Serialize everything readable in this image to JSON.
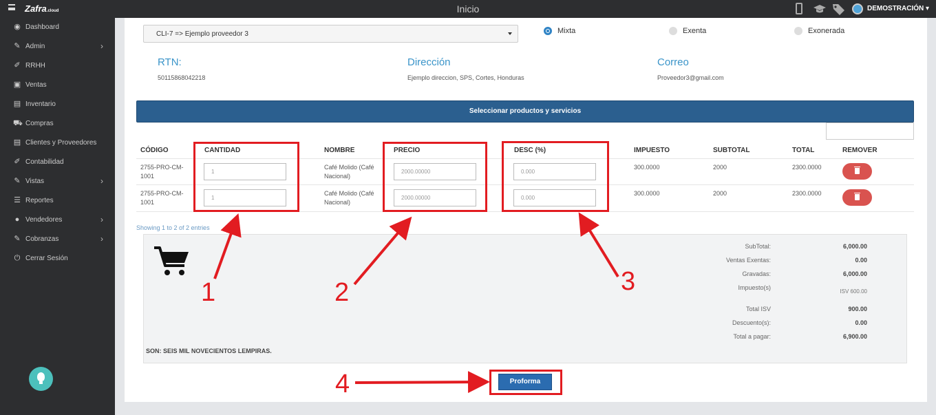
{
  "topbar": {
    "logo": "Zafra",
    "logo_suffix": ".cloud",
    "title": "Inicio",
    "user": "DEMOSTRACIÓN"
  },
  "sidebar": {
    "items": [
      {
        "label": "Dashboard",
        "icon": "dashboard-icon",
        "glyph": "◉",
        "has_submenu": false
      },
      {
        "label": "Admin",
        "icon": "wrench-icon",
        "glyph": "✎",
        "has_submenu": true
      },
      {
        "label": "RRHH",
        "icon": "paperclip-icon",
        "glyph": "✐",
        "has_submenu": false
      },
      {
        "label": "Ventas",
        "icon": "money-icon",
        "glyph": "▣",
        "has_submenu": false
      },
      {
        "label": "Inventario",
        "icon": "book-icon",
        "glyph": "▤",
        "has_submenu": false
      },
      {
        "label": "Compras",
        "icon": "cart-icon",
        "glyph": "⛟",
        "has_submenu": false
      },
      {
        "label": "Clientes y Proveedores",
        "icon": "book-icon",
        "glyph": "▤",
        "has_submenu": false
      },
      {
        "label": "Contabilidad",
        "icon": "paperclip-icon",
        "glyph": "✐",
        "has_submenu": false
      },
      {
        "label": "Vistas",
        "icon": "edit-icon",
        "glyph": "✎",
        "has_submenu": true
      },
      {
        "label": "Reportes",
        "icon": "list-icon",
        "glyph": "☰",
        "has_submenu": false
      },
      {
        "label": "Vendedores",
        "icon": "user-icon",
        "glyph": "●",
        "has_submenu": true
      },
      {
        "label": "Cobranzas",
        "icon": "edit-icon",
        "glyph": "✎",
        "has_submenu": true
      },
      {
        "label": "Cerrar Sesión",
        "icon": "power-icon",
        "glyph": "⏻",
        "has_submenu": false
      }
    ]
  },
  "form": {
    "supplier_select": "CLI-7 => Ejemplo proveedor 3",
    "radios": [
      {
        "label": "Mixta",
        "selected": true
      },
      {
        "label": "Exenta",
        "selected": false
      },
      {
        "label": "Exonerada",
        "selected": false
      }
    ],
    "rtn_label": "RTN:",
    "rtn_value": "50115868042218",
    "address_label": "Dirección",
    "address_value": "Ejemplo direccion, SPS, Cortes, Honduras",
    "email_label": "Correo",
    "email_value": "Proveedor3@gmail.com",
    "select_products_button": "Seleccionar productos y servicios",
    "search_value": ""
  },
  "table": {
    "headers": [
      "CÓDIGO",
      "CANTIDAD",
      "NOMBRE",
      "PRECIO",
      "DESC (%)",
      "IMPUESTO",
      "SUBTOTAL",
      "TOTAL",
      "REMOVER"
    ],
    "rows": [
      {
        "code_l1": "2755-PRO-CM-",
        "code_l2": "1001",
        "qty": "1",
        "name_l1": "Café Molido (Café",
        "name_l2": "Nacional)",
        "price": "2000.00000",
        "discount": "0.000",
        "tax": "300.0000",
        "subtotal": "2000",
        "total": "2300.0000"
      },
      {
        "code_l1": "2755-PRO-CM-",
        "code_l2": "1001",
        "qty": "1",
        "name_l1": "Café Molido (Café",
        "name_l2": "Nacional)",
        "price": "2000.00000",
        "discount": "0.000",
        "tax": "300.0000",
        "subtotal": "2000",
        "total": "2300.0000"
      }
    ],
    "entries_info": "Showing 1 to 2 of 2 entries"
  },
  "summary": {
    "subtotal_label": "SubTotal:",
    "subtotal": "6,000.00",
    "exentas_label": "Ventas Exentas:",
    "exentas": "0.00",
    "gravadas_label": "Gravadas:",
    "gravadas": "6,000.00",
    "impuesto_label": "Impuesto(s)",
    "impuesto": "ISV 600.00",
    "total_isv_label": "Total ISV",
    "total_isv": "900.00",
    "descuento_label": "Descuento(s):",
    "descuento": "0.00",
    "total_label": "Total a pagar:",
    "total": "6,900.00",
    "amount_words": "SON: SEIS MIL NOVECIENTOS LEMPIRAS."
  },
  "proforma_button": "Proforma",
  "annotations": {
    "n1": "1",
    "n2": "2",
    "n3": "3",
    "n4": "4",
    "color": "#e21c21"
  },
  "colors": {
    "accent": "#3a94c9",
    "bar": "#2b5f8f",
    "danger": "#d9534f",
    "sidebar": "#2d2e30"
  }
}
